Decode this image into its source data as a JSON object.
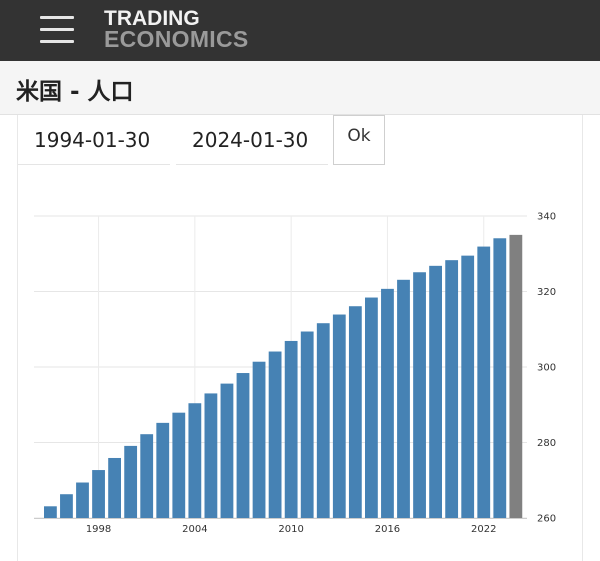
{
  "header": {
    "menu_icon": "hamburger-menu-icon",
    "logo_line1": "TRADING",
    "logo_line2": "ECONOMICS"
  },
  "page": {
    "title": "米国 - 人口"
  },
  "date_range": {
    "start": "1994-01-30",
    "end": "2024-01-30",
    "ok_label": "Ok"
  },
  "colors": {
    "bar": "#4682b4",
    "forecast_bar": "#808080",
    "topbar": "#333333"
  },
  "chart_data": {
    "type": "bar",
    "x": [
      1995,
      1996,
      1997,
      1998,
      1999,
      2000,
      2001,
      2002,
      2003,
      2004,
      2005,
      2006,
      2007,
      2008,
      2009,
      2010,
      2011,
      2012,
      2013,
      2014,
      2015,
      2016,
      2017,
      2018,
      2019,
      2020,
      2021,
      2022,
      2023,
      2024
    ],
    "values": [
      263.1,
      266.3,
      269.4,
      272.7,
      275.9,
      279.1,
      282.2,
      285.2,
      287.9,
      290.4,
      293.0,
      295.6,
      298.4,
      301.4,
      304.1,
      306.9,
      309.4,
      311.6,
      313.9,
      316.1,
      318.4,
      320.7,
      323.1,
      325.1,
      326.8,
      328.3,
      329.5,
      331.9,
      334.1,
      335.0
    ],
    "forecast_from": 2024,
    "ylim": [
      260,
      340
    ],
    "yticks": [
      260,
      280,
      300,
      320,
      340
    ],
    "xticks": [
      1998,
      2004,
      2010,
      2016,
      2022
    ],
    "y_axis_position": "right",
    "grid": true,
    "title": "",
    "xlabel": "",
    "ylabel": ""
  }
}
